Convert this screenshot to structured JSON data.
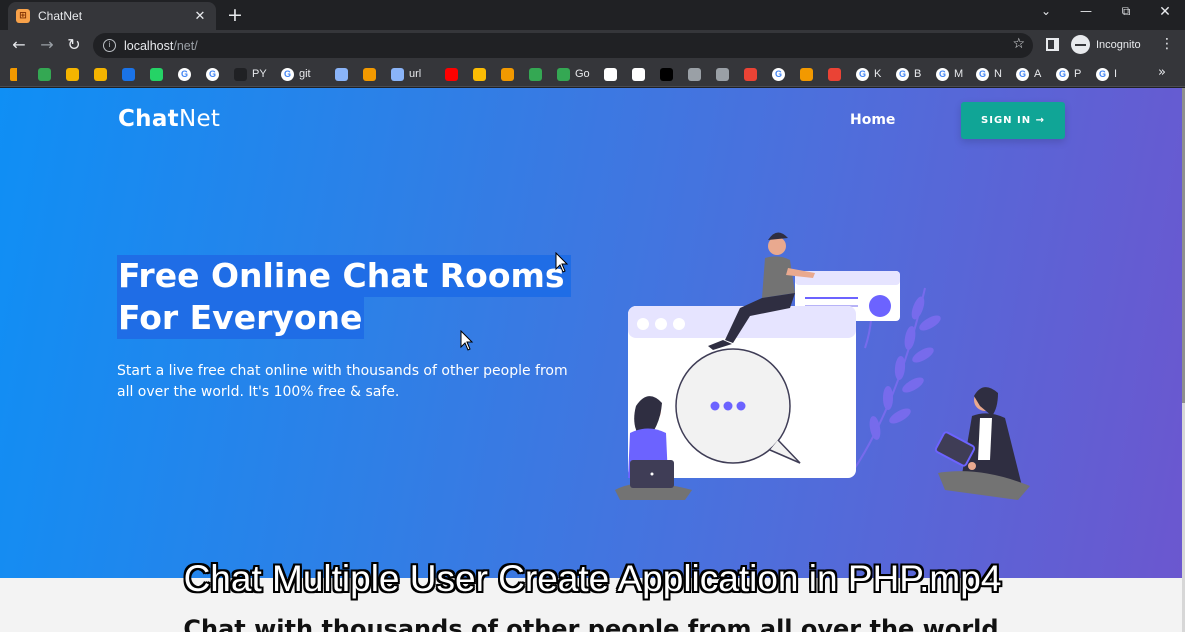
{
  "browser": {
    "tab_title": "ChatNet",
    "tab_favicon": "xampp-icon",
    "url_host": "localhost",
    "url_path": "/net/",
    "profile_label": "Incognito",
    "bookmarks": [
      {
        "icon": "bookmark-icon",
        "label": "",
        "color": "#f29900"
      },
      {
        "icon": "swirl-icon",
        "label": "",
        "color": "#34a853"
      },
      {
        "icon": "shield-icon",
        "label": "",
        "color": "#f4b400"
      },
      {
        "icon": "bar-chart-icon",
        "label": "",
        "color": "#f4b400"
      },
      {
        "icon": "ieee-icon",
        "label": "",
        "color": "#1a73e8"
      },
      {
        "icon": "whatsapp-icon",
        "label": "",
        "color": "#25d366"
      },
      {
        "icon": "google-icon",
        "label": ""
      },
      {
        "icon": "google-icon",
        "label": ""
      },
      {
        "icon": "github-icon",
        "label": "PY",
        "color": "#202124"
      },
      {
        "icon": "google-icon",
        "label": "git"
      },
      {
        "icon": "car-icon",
        "label": "",
        "color": "#8ab4f8"
      },
      {
        "icon": "cone-icon",
        "label": "",
        "color": "#f29900"
      },
      {
        "icon": "url-icon",
        "label": "url",
        "color": "#8ab4f8"
      },
      {
        "icon": "youtube-icon",
        "label": "",
        "color": "#ff0000"
      },
      {
        "icon": "p-icon",
        "label": "",
        "color": "#fbbc04"
      },
      {
        "icon": "camera-icon",
        "label": "",
        "color": "#f29900"
      },
      {
        "icon": "circle-icon",
        "label": "",
        "color": "#34a853"
      },
      {
        "icon": "swirl-icon",
        "label": "Go",
        "color": "#34a853"
      },
      {
        "icon": "app-icon",
        "label": "",
        "color": "#ffffff"
      },
      {
        "icon": "app-icon",
        "label": "",
        "color": "#ffffff"
      },
      {
        "icon": "ci-icon",
        "label": "",
        "color": "#000000"
      },
      {
        "icon": "globe-icon",
        "label": "",
        "color": "#9aa0a6"
      },
      {
        "icon": "globe-icon",
        "label": "",
        "color": "#9aa0a6"
      },
      {
        "icon": "yandex-icon",
        "label": "",
        "color": "#ea4335"
      },
      {
        "icon": "google-icon",
        "label": ""
      },
      {
        "icon": "arrow-icon",
        "label": "",
        "color": "#f29900"
      },
      {
        "icon": "face-icon",
        "label": "",
        "color": "#ea4335"
      },
      {
        "icon": "google-icon",
        "label": "K"
      },
      {
        "icon": "google-icon",
        "label": "B"
      },
      {
        "icon": "google-icon",
        "label": "M"
      },
      {
        "icon": "google-icon",
        "label": "N"
      },
      {
        "icon": "google-icon",
        "label": "A"
      },
      {
        "icon": "google-icon",
        "label": "P"
      },
      {
        "icon": "google-icon",
        "label": "I"
      }
    ]
  },
  "site": {
    "brand_bold": "Chat",
    "brand_light": "Net",
    "nav_home": "Home",
    "signin_label": "SIGN IN →",
    "headline_line1": "Free Online Chat Rooms",
    "headline_line2": "For Everyone",
    "subtext": "Start a live free chat online with thousands of other people from all over the world. It's 100% free & safe.",
    "lower_heading": "Chat with thousands of other people from all over the world"
  },
  "video_caption": "Chat Multiple User Create Application in PHP.mp4",
  "colors": {
    "gradient_start": "#0f8ff5",
    "gradient_end": "#6b57cf",
    "signin_bg": "#10a596",
    "selection": "#1f6de6",
    "illustration_accent": "#6c63ff"
  }
}
